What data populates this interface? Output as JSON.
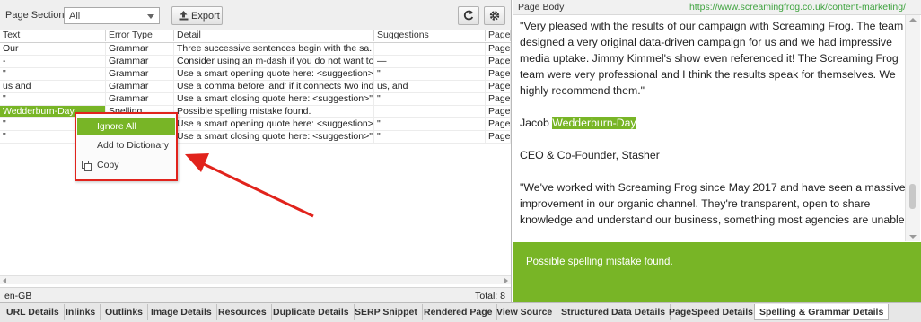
{
  "toolbar": {
    "page_section_label": "Page Section:",
    "page_section_value": "All",
    "export_label": "Export",
    "icons": {
      "export": "upload-icon",
      "refresh": "refresh-icon",
      "settings": "gear-icon"
    }
  },
  "table": {
    "columns": [
      "Text",
      "Error Type",
      "Detail",
      "Suggestions",
      "Page"
    ],
    "rows": [
      {
        "text": "Our",
        "type": "Grammar",
        "detail": "Three successive sentences begin with the sa...",
        "suggestions": "",
        "page": "Page"
      },
      {
        "text": "-",
        "type": "Grammar",
        "detail": "Consider using an m-dash if you do not want to...",
        "suggestions": "—",
        "page": "Page"
      },
      {
        "text": "\"",
        "type": "Grammar",
        "detail": "Use a smart opening quote here: <suggestion>...",
        "suggestions": "\"",
        "page": "Page"
      },
      {
        "text": "us and",
        "type": "Grammar",
        "detail": "Use a comma before 'and' if it connects two ind...",
        "suggestions": "us, and",
        "page": "Page"
      },
      {
        "text": "\"",
        "type": "Grammar",
        "detail": "Use a smart closing quote here: <suggestion>\"...",
        "suggestions": "\"",
        "page": "Page"
      },
      {
        "text": "Wedderburn-Day",
        "type": "Spelling",
        "detail": "Possible spelling mistake found.",
        "suggestions": "",
        "page": "Page"
      },
      {
        "text": "\"",
        "type": "Grammar",
        "detail": "Use a smart opening quote here: <suggestion>...",
        "suggestions": "\"",
        "page": "Page"
      },
      {
        "text": "\"",
        "type": "Grammar",
        "detail": "Use a smart closing quote here: <suggestion>\"...",
        "suggestions": "\"",
        "page": "Page"
      }
    ]
  },
  "context_menu": {
    "items": [
      "Ignore All",
      "Add to Dictionary",
      "Copy"
    ]
  },
  "status": {
    "language": "en-GB",
    "total_label": "Total:",
    "total_value": "8"
  },
  "page_body": {
    "title": "Page Body",
    "url": "https://www.screamingfrog.co.uk/content-marketing/",
    "para1": "\"Very pleased with the results of our campaign with Screaming Frog. The team designed a very original data-driven campaign for us and we had impressive media uptake. Jimmy Kimmel's show even referenced it! The Screaming Frog team were very professional and I think the results speak for themselves. We highly recommend them.\"",
    "name_first": "Jacob ",
    "name_highlight": "Wedderburn-Day",
    "role": "CEO & Co-Founder, Stasher",
    "para2": "\"We've worked with Screaming Frog since May 2017 and have seen a massive improvement in our organic channel. They're transparent, open to share knowledge and understand our business, something most agencies are unable",
    "message": "Possible spelling mistake found."
  },
  "tabs": [
    "URL Details",
    "Inlinks",
    "Outlinks",
    "Image Details",
    "Resources",
    "Duplicate Details",
    "SERP Snippet",
    "Rendered Page",
    "View Source",
    "Structured Data Details",
    "PageSpeed Details",
    "Spelling & Grammar Details"
  ],
  "colors": {
    "accent_green": "#78b526",
    "highlight_red": "#e1231c",
    "url_green": "#3fa33f"
  }
}
